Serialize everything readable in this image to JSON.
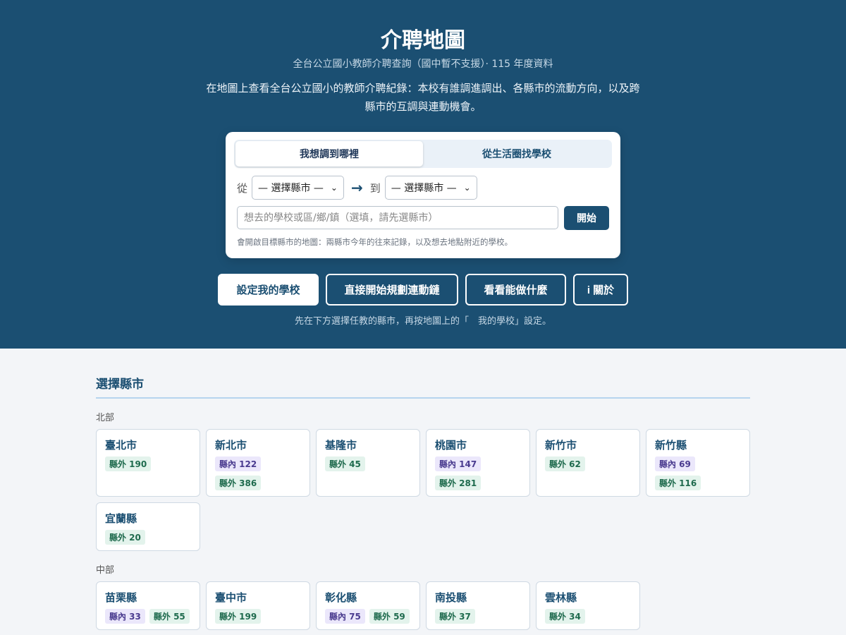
{
  "header": {
    "title": "介聘地圖",
    "subtitle": "全台公立國小教師介聘查詢（國中暫不支援）· 115 年度資料",
    "description": "在地圖上查看全台公立國小的教師介聘紀錄：本校有誰調進調出、各縣市的流動方向，以及跨縣市的互調與連動機會。"
  },
  "search_card": {
    "tabs": [
      {
        "label": "我想調到哪裡",
        "active": true
      },
      {
        "label": "從生活圈找學校",
        "active": false
      }
    ],
    "from_label": "從",
    "to_label": "到",
    "from_select": "— 選擇縣市 —",
    "to_select": "— 選擇縣市 —",
    "input_placeholder": "想去的學校或區/鄉/鎮（選填，請先選縣市）",
    "start_button": "開始",
    "hint": "會開啟目標縣市的地圖：兩縣市今年的往來記錄，以及想去地點附近的學校。"
  },
  "actions": [
    {
      "label": "設定我的學校",
      "primary": true
    },
    {
      "label": "直接開始規劃連動鏈",
      "primary": false
    },
    {
      "label": "看看能做什麼",
      "primary": false
    },
    {
      "label": "i 關於",
      "primary": false
    }
  ],
  "action_note": "先在下方選擇任教的縣市，再按地圖上的「　我的學校」設定。",
  "county_section": {
    "title": "選擇縣市",
    "regions": [
      {
        "name": "北部",
        "counties": [
          {
            "name": "臺北市",
            "badges": [
              {
                "type": "out",
                "label": "縣外 190"
              }
            ]
          },
          {
            "name": "新北市",
            "badges": [
              {
                "type": "in",
                "label": "縣內 122"
              },
              {
                "type": "out",
                "label": "縣外 386"
              }
            ]
          },
          {
            "name": "基隆市",
            "badges": [
              {
                "type": "out",
                "label": "縣外 45"
              }
            ]
          },
          {
            "name": "桃園市",
            "badges": [
              {
                "type": "in",
                "label": "縣內 147"
              },
              {
                "type": "out",
                "label": "縣外 281"
              }
            ]
          },
          {
            "name": "新竹市",
            "badges": [
              {
                "type": "out",
                "label": "縣外 62"
              }
            ]
          },
          {
            "name": "新竹縣",
            "badges": [
              {
                "type": "in",
                "label": "縣內 69"
              },
              {
                "type": "out",
                "label": "縣外 116"
              }
            ]
          },
          {
            "name": "宜蘭縣",
            "badges": [
              {
                "type": "out",
                "label": "縣外 20"
              }
            ]
          }
        ]
      },
      {
        "name": "中部",
        "counties": [
          {
            "name": "苗栗縣",
            "badges": [
              {
                "type": "in",
                "label": "縣內 33"
              },
              {
                "type": "out",
                "label": "縣外 55"
              }
            ]
          },
          {
            "name": "臺中市",
            "badges": [
              {
                "type": "out",
                "label": "縣外 199"
              }
            ]
          },
          {
            "name": "彰化縣",
            "badges": [
              {
                "type": "in",
                "label": "縣內 75"
              },
              {
                "type": "out",
                "label": "縣外 59"
              }
            ]
          },
          {
            "name": "南投縣",
            "badges": [
              {
                "type": "out",
                "label": "縣外 37"
              }
            ]
          },
          {
            "name": "雲林縣",
            "badges": [
              {
                "type": "out",
                "label": "縣外 34"
              }
            ]
          }
        ]
      }
    ]
  }
}
